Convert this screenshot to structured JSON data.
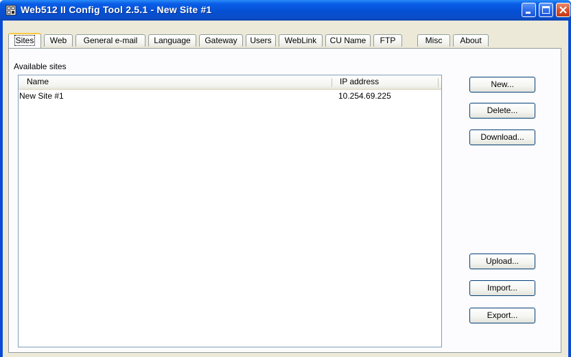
{
  "window": {
    "title": "Web512 II Config Tool 2.5.1 - New Site #1",
    "controls": [
      "minimize-icon",
      "maximize-icon",
      "close-icon"
    ]
  },
  "tabs": [
    {
      "label": "Sites",
      "active": true
    },
    {
      "label": "Web"
    },
    {
      "label": "General e-mail"
    },
    {
      "label": "Language"
    },
    {
      "label": "Gateway"
    },
    {
      "label": "Users"
    },
    {
      "label": "WebLink"
    },
    {
      "label": "CU Name"
    },
    {
      "label": "FTP"
    },
    {
      "label": "Misc"
    },
    {
      "label": "About"
    }
  ],
  "sites": {
    "section_label": "Available sites",
    "columns": [
      "Name",
      "IP address"
    ],
    "rows": [
      {
        "name": "New Site #1",
        "ip": "10.254.69.225"
      }
    ]
  },
  "buttons": {
    "new": "New...",
    "delete": "Delete...",
    "download": "Download...",
    "upload": "Upload...",
    "import": "Import...",
    "export": "Export..."
  },
  "colors": {
    "titlebar": "#0550d4",
    "close_button": "#d64a24",
    "active_tab_accent": "#ffc83c",
    "dialog_face": "#ece9d8"
  }
}
